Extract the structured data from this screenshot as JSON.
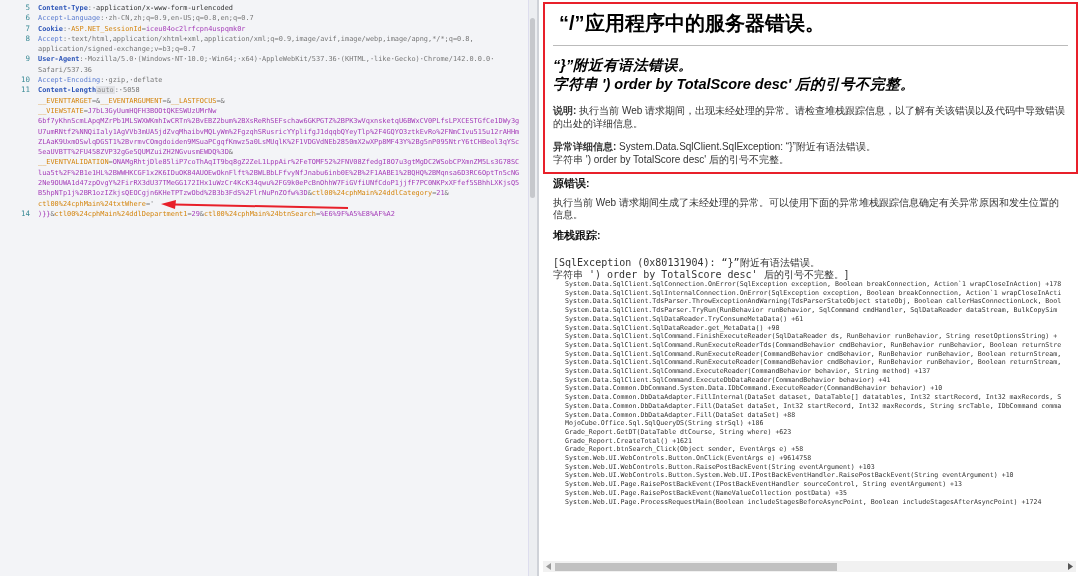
{
  "request_editor": {
    "lines": [
      {
        "number": "5",
        "segments": [
          {
            "kind": "header-name",
            "text": "Content-Type"
          },
          {
            "kind": "punct",
            "text": ":·"
          },
          {
            "kind": "header-value-dark",
            "text": "application/x-www-form-urlencoded"
          }
        ]
      },
      {
        "number": "6",
        "segments": [
          {
            "kind": "header-name-light",
            "text": "Accept-Language"
          },
          {
            "kind": "punct",
            "text": ":·"
          },
          {
            "kind": "header-value",
            "text": "zh-CN,zh;q=0.9,en-US;q=0.8,en;q=0.7"
          }
        ]
      },
      {
        "number": "7",
        "segments": [
          {
            "kind": "header-name",
            "text": "Cookie"
          },
          {
            "kind": "punct",
            "text": ":·"
          },
          {
            "kind": "param-name",
            "text": "ASP.NET_SessionId"
          },
          {
            "kind": "punct",
            "text": "="
          },
          {
            "kind": "param-value",
            "text": "iceu04oc2lrfcpn4uspqmk0r"
          }
        ]
      },
      {
        "number": "8",
        "segments": [
          {
            "kind": "header-name-light",
            "text": "Accept"
          },
          {
            "kind": "punct",
            "text": ":·"
          },
          {
            "kind": "header-value",
            "text": "text/html,application/xhtml+xml,application/xml;q=0.9,image/avif,image/webp,image/apng,*/*;q=0.8,"
          }
        ]
      },
      {
        "segments": [
          {
            "kind": "header-value",
            "text": "application/signed-exchange;v=b3;q=0.7"
          }
        ]
      },
      {
        "number": "9",
        "segments": [
          {
            "kind": "header-name",
            "text": "User-Agent"
          },
          {
            "kind": "punct",
            "text": ":·"
          },
          {
            "kind": "header-value",
            "text": "Mozilla/5.0·(Windows·NT·10.0;·Win64;·x64)·AppleWebKit/537.36·(KHTML,·like·Gecko)·Chrome/142.0.0.0·"
          }
        ]
      },
      {
        "segments": [
          {
            "kind": "header-value",
            "text": "Safari/537.36"
          }
        ]
      },
      {
        "number": "10",
        "segments": [
          {
            "kind": "header-name-light",
            "text": "Accept-Encoding"
          },
          {
            "kind": "punct",
            "text": ":·"
          },
          {
            "kind": "header-value",
            "text": "gzip,·deflate"
          }
        ]
      },
      {
        "number": "11",
        "segments": [
          {
            "kind": "header-name",
            "text": "Content-Length"
          },
          {
            "kind": "badge",
            "text": "auto"
          },
          {
            "kind": "punct",
            "text": ":·"
          },
          {
            "kind": "header-value",
            "text": "5058"
          }
        ]
      },
      {
        "segments": [
          {
            "kind": "param-name",
            "text": "__EVENTTARGET"
          },
          {
            "kind": "punct",
            "text": "=&"
          },
          {
            "kind": "param-name",
            "text": "__EVENTARGUMENT"
          },
          {
            "kind": "punct",
            "text": "=&"
          },
          {
            "kind": "param-name",
            "text": "__LASTFOCUS"
          },
          {
            "kind": "punct",
            "text": "=&"
          }
        ]
      },
      {
        "segments": [
          {
            "kind": "param-name",
            "text": "__VIEWSTATE"
          },
          {
            "kind": "punct",
            "text": "="
          },
          {
            "kind": "param-value",
            "text": "J7bL3GyUumHQFH3BOOtQKESWUzUMrNw"
          }
        ]
      },
      {
        "segments": [
          {
            "kind": "param-value",
            "text": "6bf7yKhnScmLApqMZrPb1MLSWXWKmhIwCRTn%2BvEBZ2bum%2BXsReRhSEFschaw6GKPGTZ%2BPK3wVqxnsketqU6BWxCV0PLfsLPXCESTGfCe1DWy3g"
          }
        ]
      },
      {
        "segments": [
          {
            "kind": "param-value",
            "text": "U7umRNtf2%NNQiIaly1AgVVb3mUA5jdZvqMhaibvMQLyWm%2FgzqhSRusricYYplifgJ1dqqbQYeyTlp%2F4GQYO3ztkEvRo%2FNmCIvu515u12rAHHm"
          }
        ]
      },
      {
        "segments": [
          {
            "kind": "param-value",
            "text": "ZLAaK9UxmOSwlqDGST1%2BvrmvCOmgdoiden9MSuaPCgqfKmwz5a0LsMUqlK%2F1VDGVdNEb2850mX2wXPp8MF43Y%2Bg5nP095NtrY6tCHBeol3qYSc"
          }
        ]
      },
      {
        "segments": [
          {
            "kind": "param-value",
            "text": "5eaUVBTT%2FU458ZVP32gGe5QUMZuiZH2NGvusmEWDQ%3D"
          },
          {
            "kind": "punct",
            "text": "&"
          }
        ]
      },
      {
        "segments": [
          {
            "kind": "param-name",
            "text": "__EVENTVALIDATION"
          },
          {
            "kind": "punct",
            "text": "="
          },
          {
            "kind": "param-value",
            "text": "ONAMgRhtjDle85liP7coThAqIT9bq8gZ2ZeL1LppAir%2FeTOMF52%2FNV08ZfedgI8O7u3gtMgDC2WSobCPXmnZM5Ls3G78SC"
          }
        ]
      },
      {
        "segments": [
          {
            "kind": "param-value",
            "text": "lua5t%2F%2B1e1HL%2BWWHKCGF1x2K6IDuOK84AUOEwOknFlft%2BWLBbLFfvyNfJnabu6inb0E%2B%2F1AABE1%2BQHQ%2BMqnsa6D3RC6OptTn5cNG"
          }
        ]
      },
      {
        "segments": [
          {
            "kind": "param-value",
            "text": "2Ne9OUWA1d47zpOvgY%2FirRX3dU37TMeGG172IHx1uWzCr4KcK34qwu%2FG9k0ePcBnOhhW7FiGVfiUNfCdoP1jjfF7PC0NKPxXFfef5SBhhLXKjsQ5"
          }
        ]
      },
      {
        "segments": [
          {
            "kind": "param-value",
            "text": "B5hpNTp1j%2BR1ozIZkjsQEOCgjn6KHeTPTzwObd%2B3b3FdS%2FlrNuPnZOfw%3D"
          },
          {
            "kind": "punct",
            "text": "&"
          },
          {
            "kind": "param-name",
            "text": "ctl00%24cphMain%24ddlCategory"
          },
          {
            "kind": "punct",
            "text": "="
          },
          {
            "kind": "param-value",
            "text": "21"
          },
          {
            "kind": "punct",
            "text": "&"
          }
        ]
      },
      {
        "marked": true,
        "segments": [
          {
            "kind": "param-name",
            "text": "ctl00%24cphMain%24txtWhere"
          },
          {
            "kind": "punct",
            "text": "='"
          }
        ]
      },
      {
        "number": "14",
        "segments": [
          {
            "kind": "param-value",
            "text": ")}}"
          },
          {
            "kind": "punct",
            "text": "&"
          },
          {
            "kind": "param-name",
            "text": "ctl00%24cphMain%24ddlDepartment1"
          },
          {
            "kind": "punct",
            "text": "="
          },
          {
            "kind": "param-value",
            "text": "29"
          },
          {
            "kind": "punct",
            "text": "&"
          },
          {
            "kind": "param-name",
            "text": "ctl00%24cphMain%24btnSearch"
          },
          {
            "kind": "punct",
            "text": "="
          },
          {
            "kind": "param-value",
            "text": "%E6%9F%A5%E8%AF%A2"
          }
        ]
      }
    ]
  },
  "annotations": {
    "error_box": true
  },
  "error_page": {
    "title": "“/”应用程序中的服务器错误。",
    "message_lines": [
      "“}”附近有语法错误。",
      "字符串 ') order by TotalScore desc' 后的引号不完整。"
    ],
    "description": "**说明:** 执行当前 Web 请求期间，出现未经处理的异常。请检查堆栈跟踪信息，以了解有关该错误以及代码中导致错误的出处的详细信息。",
    "exception_details": [
      "**异常详细信息:** System.Data.SqlClient.SqlException: “}”附近有语法错误。",
      "字符串 ') order by TotalScore desc' 后的引号不完整。"
    ],
    "source_error": {
      "heading": "源错误:",
      "text": "执行当前 Web 请求期间生成了未经处理的异常。可以使用下面的异常堆栈跟踪信息确定有关异常原因和发生位置的信息。"
    },
    "stack_trace": {
      "heading": "堆栈跟踪:",
      "exception_lines": [
        "[SqlException (0x80131904): “}”附近有语法错误。",
        "字符串 ') order by TotalScore desc' 后的引号不完整。]"
      ],
      "frames": [
        "System.Data.SqlClient.SqlConnection.OnError(SqlException exception, Boolean breakConnection, Action`1 wrapCloseInAction) +178",
        "System.Data.SqlClient.SqlInternalConnection.OnError(SqlException exception, Boolean breakConnection, Action`1 wrapCloseInActi",
        "System.Data.SqlClient.TdsParser.ThrowExceptionAndWarning(TdsParserStateObject stateObj, Boolean callerHasConnectionLock, Bool",
        "System.Data.SqlClient.TdsParser.TryRun(RunBehavior runBehavior, SqlCommand cmdHandler, SqlDataReader dataStream, BulkCopySim",
        "System.Data.SqlClient.SqlDataReader.TryConsumeMetaData() +61",
        "System.Data.SqlClient.SqlDataReader.get_MetaData() +90",
        "System.Data.SqlClient.SqlCommand.FinishExecuteReader(SqlDataReader ds, RunBehavior runBehavior, String resetOptionsString) +",
        "System.Data.SqlClient.SqlCommand.RunExecuteReaderTds(CommandBehavior cmdBehavior, RunBehavior runBehavior, Boolean returnStre",
        "System.Data.SqlClient.SqlCommand.RunExecuteReader(CommandBehavior cmdBehavior, RunBehavior runBehavior, Boolean returnStream,",
        "System.Data.SqlClient.SqlCommand.RunExecuteReader(CommandBehavior cmdBehavior, RunBehavior runBehavior, Boolean returnStream,",
        "System.Data.SqlClient.SqlCommand.ExecuteReader(CommandBehavior behavior, String method) +137",
        "System.Data.SqlClient.SqlCommand.ExecuteDbDataReader(CommandBehavior behavior) +41",
        "System.Data.Common.DbCommand.System.Data.IDbCommand.ExecuteReader(CommandBehavior behavior) +10",
        "System.Data.Common.DbDataAdapter.FillInternal(DataSet dataset, DataTable[] datatables, Int32 startRecord, Int32 maxRecords, S",
        "System.Data.Common.DbDataAdapter.Fill(DataSet dataSet, Int32 startRecord, Int32 maxRecords, String srcTable, IDbCommand comma",
        "System.Data.Common.DbDataAdapter.Fill(DataSet dataSet) +88",
        "MojoCube.Office.Sql.SqlQueryDS(String strSql) +186",
        "Grade_Report.GetDT(DataTable dtCourse, String where) +623",
        "Grade_Report.CreateTotal() +1621",
        "Grade_Report.btnSearch_Click(Object sender, EventArgs e) +58",
        "System.Web.UI.WebControls.Button.OnClick(EventArgs e) +9614758",
        "System.Web.UI.WebControls.Button.RaisePostBackEvent(String eventArgument) +103",
        "System.Web.UI.WebControls.Button.System.Web.UI.IPostBackEventHandler.RaisePostBackEvent(String eventArgument) +10",
        "System.Web.UI.Page.RaisePostBackEvent(IPostBackEventHandler sourceControl, String eventArgument) +13",
        "System.Web.UI.Page.RaisePostBackEvent(NameValueCollection postData) +35",
        "System.Web.UI.Page.ProcessRequestMain(Boolean includeStagesBeforeAsyncPoint, Boolean includeStagesAfterAsyncPoint) +1724"
      ]
    }
  }
}
